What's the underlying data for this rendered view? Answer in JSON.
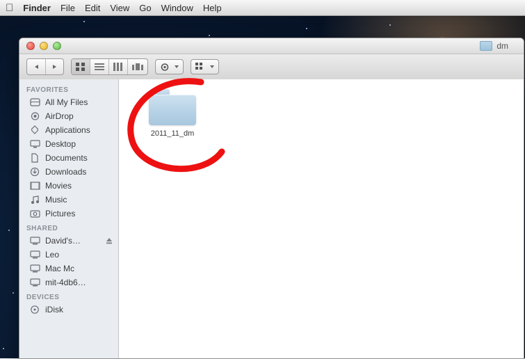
{
  "menubar": {
    "app": "Finder",
    "items": [
      "File",
      "Edit",
      "View",
      "Go",
      "Window",
      "Help"
    ]
  },
  "window": {
    "title": "dm",
    "toolbar_location": "dm"
  },
  "sidebar": {
    "sections": [
      {
        "header": "FAVORITES",
        "items": [
          {
            "icon": "all-my-files-icon",
            "label": "All My Files"
          },
          {
            "icon": "airdrop-icon",
            "label": "AirDrop"
          },
          {
            "icon": "applications-icon",
            "label": "Applications"
          },
          {
            "icon": "desktop-icon",
            "label": "Desktop"
          },
          {
            "icon": "documents-icon",
            "label": "Documents"
          },
          {
            "icon": "downloads-icon",
            "label": "Downloads"
          },
          {
            "icon": "movies-icon",
            "label": "Movies"
          },
          {
            "icon": "music-icon",
            "label": "Music"
          },
          {
            "icon": "pictures-icon",
            "label": "Pictures"
          }
        ]
      },
      {
        "header": "SHARED",
        "items": [
          {
            "icon": "computer-icon",
            "label": "David's…",
            "eject": true
          },
          {
            "icon": "computer-icon",
            "label": "Leo"
          },
          {
            "icon": "computer-icon",
            "label": "Mac Mc"
          },
          {
            "icon": "computer-icon",
            "label": "mit-4db6…"
          }
        ]
      },
      {
        "header": "DEVICES",
        "items": [
          {
            "icon": "idisk-icon",
            "label": "iDisk"
          }
        ]
      }
    ]
  },
  "content": {
    "items": [
      {
        "type": "folder",
        "label": "2011_11_dm"
      }
    ]
  }
}
